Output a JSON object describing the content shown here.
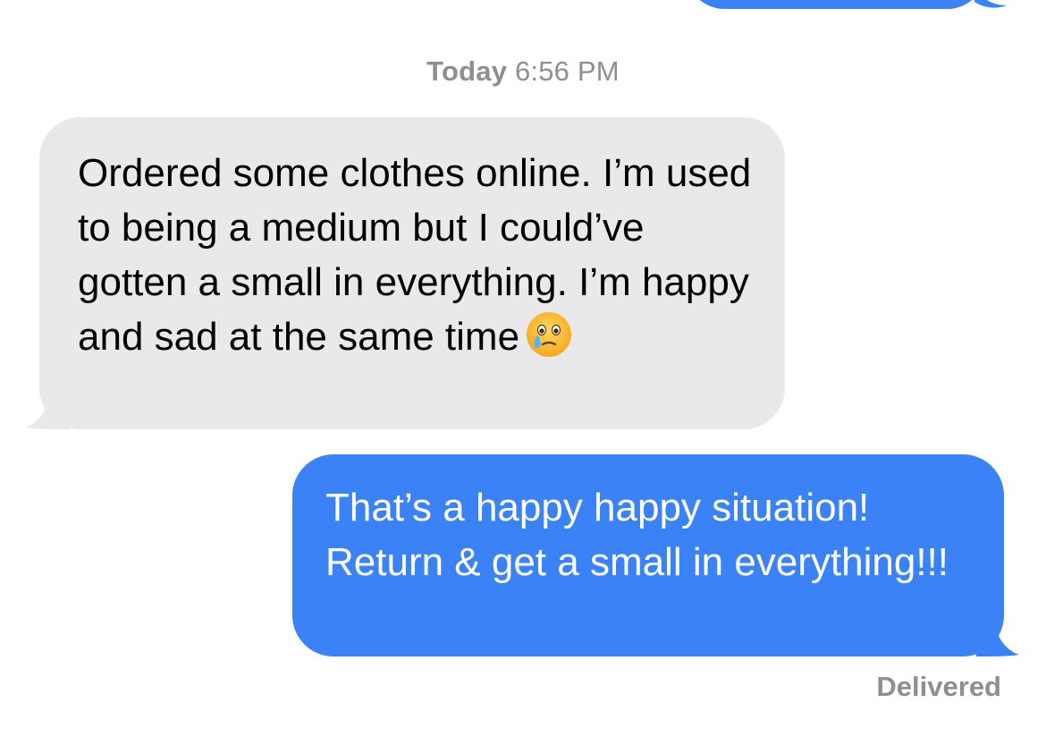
{
  "conversation": {
    "timestamp": {
      "day": "Today",
      "time": "6:56 PM"
    },
    "messages": [
      {
        "direction": "incoming",
        "text": "Ordered some clothes online. I’m used to being a medium but I could’ve gotten a small in everything. I’m happy and sad at the same time",
        "emoji": "face-holding-back-tears-icon"
      },
      {
        "direction": "outgoing",
        "text": "That’s a happy happy situation! Return & get a small in everything!!!"
      }
    ],
    "status": "Delivered"
  },
  "colors": {
    "incoming_bubble": "#e9e9eb",
    "outgoing_bubble": "#3a82f6",
    "meta_text": "#8e8e93"
  }
}
